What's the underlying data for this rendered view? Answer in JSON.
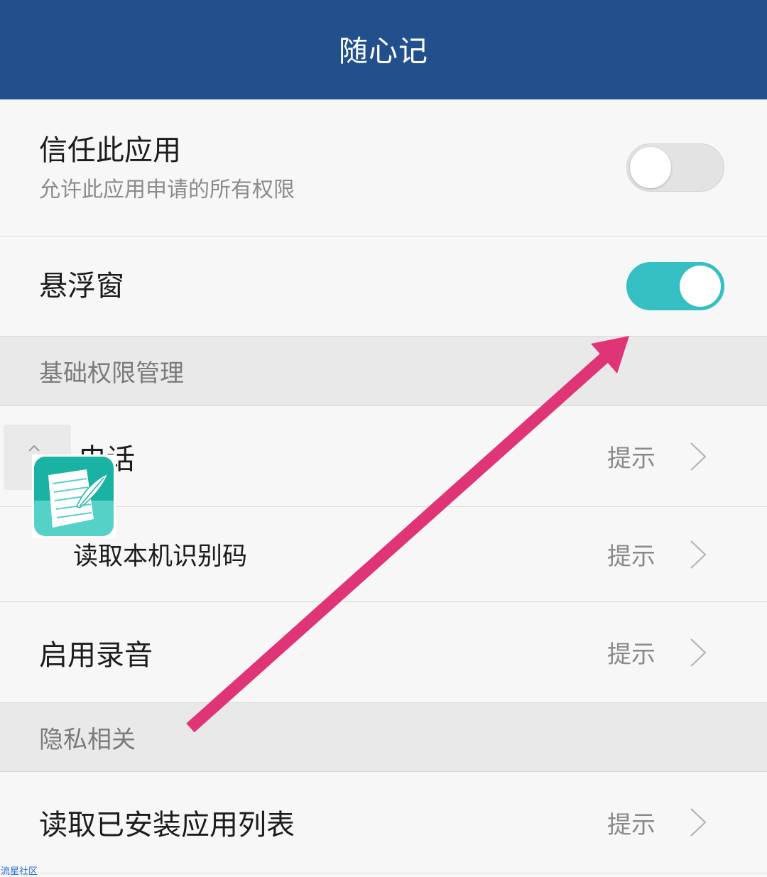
{
  "header": {
    "title": "随心记"
  },
  "trust": {
    "title": "信任此应用",
    "subtitle": "允许此应用申请的所有权限",
    "enabled": false
  },
  "floating_window": {
    "title": "悬浮窗",
    "enabled": true
  },
  "sections": [
    {
      "title": "基础权限管理",
      "items": [
        {
          "label": "电话",
          "value": "提示"
        },
        {
          "label": "读取本机识别码",
          "value": "提示"
        },
        {
          "label": "启用录音",
          "value": "提示"
        }
      ]
    },
    {
      "title": "隐私相关",
      "items": [
        {
          "label": "读取已安装应用列表",
          "value": "提示"
        }
      ]
    }
  ],
  "icons": {
    "row_chevron": "chevron-right-icon",
    "overlay_collapse": "chevron-up-icon",
    "overlay_app": "notes-app-icon"
  },
  "watermark": "流星社区",
  "colors": {
    "header": "#22508c",
    "accent": "#35bfc3",
    "arrow": "#df3577"
  }
}
